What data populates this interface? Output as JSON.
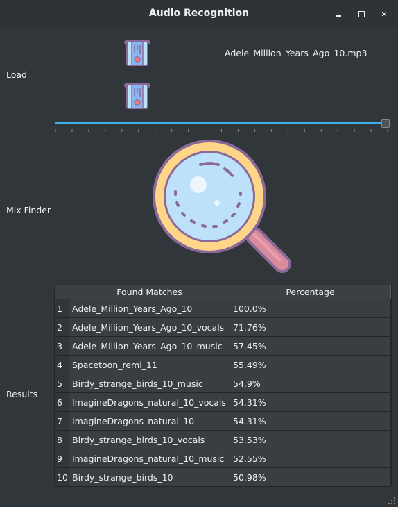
{
  "window": {
    "title": "Audio Recognition",
    "buttons": {
      "minimize": "minimize-icon",
      "maximize": "maximize-icon",
      "close": "close-icon"
    }
  },
  "sections": {
    "load_label": "Load",
    "mix_label": "Mix Finder",
    "results_label": "Results"
  },
  "load": {
    "file1_icon": "audio-file-icon",
    "file2_icon": "audio-file-icon",
    "file1_name": "Adele_Million_Years_Ago_10.mp3"
  },
  "mix_slider": {
    "value_fraction": 1.0
  },
  "finder": {
    "icon": "magnifier-icon"
  },
  "results": {
    "columns": [
      "Found Matches",
      "Percentage"
    ],
    "rows": [
      {
        "index": "1",
        "match": "Adele_Million_Years_Ago_10",
        "percentage": "100.0%"
      },
      {
        "index": "2",
        "match": "Adele_Million_Years_Ago_10_vocals",
        "percentage": "71.76%"
      },
      {
        "index": "3",
        "match": "Adele_Million_Years_Ago_10_music",
        "percentage": "57.45%"
      },
      {
        "index": "4",
        "match": "Spacetoon_remi_11",
        "percentage": "55.49%"
      },
      {
        "index": "5",
        "match": "Birdy_strange_birds_10_music",
        "percentage": "54.9%"
      },
      {
        "index": "6",
        "match": "ImagineDragons_natural_10_vocals",
        "percentage": "54.31%"
      },
      {
        "index": "7",
        "match": "ImagineDragons_natural_10",
        "percentage": "54.31%"
      },
      {
        "index": "8",
        "match": "Birdy_strange_birds_10_vocals",
        "percentage": "53.53%"
      },
      {
        "index": "9",
        "match": "ImagineDragons_natural_10_music",
        "percentage": "52.55%"
      },
      {
        "index": "10",
        "match": "Birdy_strange_birds_10",
        "percentage": "50.98%"
      }
    ]
  },
  "colors": {
    "background": "#31363b",
    "accent": "#3daee9",
    "magnifier_frame": "#ffd587",
    "magnifier_outline": "#8b6a9a",
    "magnifier_glass": "#bde0fb"
  }
}
